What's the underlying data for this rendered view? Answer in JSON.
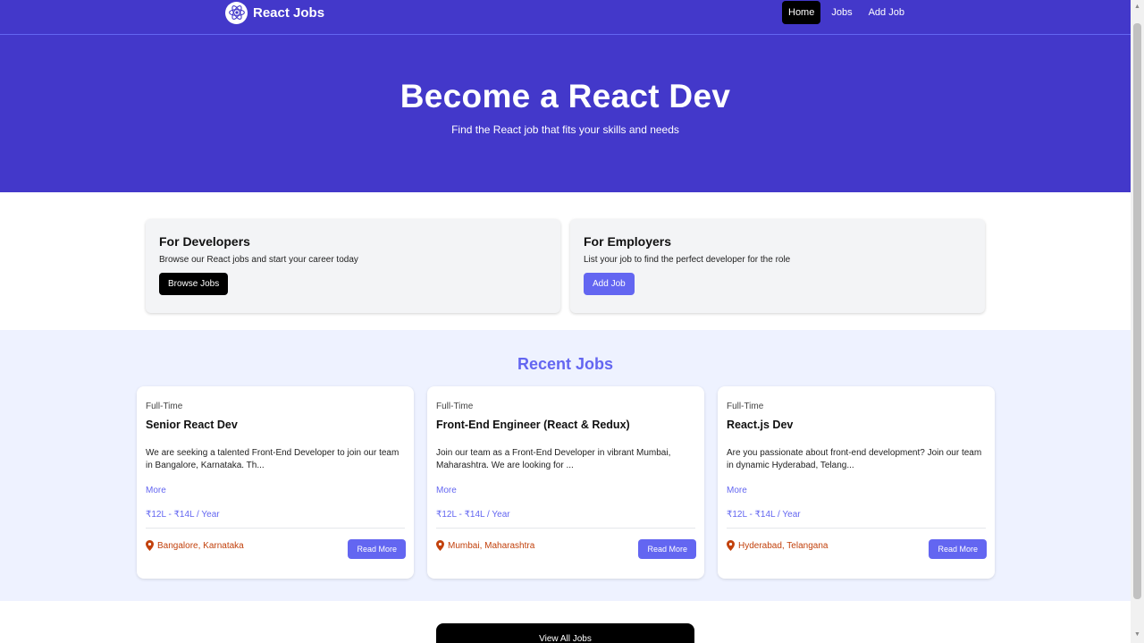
{
  "nav": {
    "brand": "React Jobs",
    "links": [
      "Home",
      "Jobs",
      "Add Job"
    ]
  },
  "hero": {
    "title": "Become a React Dev",
    "subtitle": "Find the React job that fits your skills and needs"
  },
  "info_cards": [
    {
      "title": "For Developers",
      "text": "Browse our React jobs and start your career today",
      "button": "Browse Jobs"
    },
    {
      "title": "For Employers",
      "text": "List your job to find the perfect developer for the role",
      "button": "Add Job"
    }
  ],
  "recent": {
    "title": "Recent Jobs",
    "jobs": [
      {
        "type": "Full-Time",
        "title": "Senior React Dev",
        "desc": "We are seeking a talented Front-End Developer to join our team in Bangalore, Karnataka. Th...",
        "more": "More",
        "salary": "₹12L - ₹14L / Year",
        "location": "Bangalore, Karnataka",
        "button": "Read More"
      },
      {
        "type": "Full-Time",
        "title": "Front-End Engineer (React & Redux)",
        "desc": "Join our team as a Front-End Developer in vibrant Mumbai, Maharashtra. We are looking for ...",
        "more": "More",
        "salary": "₹12L - ₹14L / Year",
        "location": "Mumbai, Maharashtra",
        "button": "Read More"
      },
      {
        "type": "Full-Time",
        "title": "React.js Dev",
        "desc": "Are you passionate about front-end development? Join our team in dynamic Hyderabad, Telang...",
        "more": "More",
        "salary": "₹12L - ₹14L / Year",
        "location": "Hyderabad, Telangana",
        "button": "Read More"
      }
    ]
  },
  "view_all": "View All Jobs",
  "colors": {
    "primary": "#4338ca",
    "accent": "#6366f1",
    "location": "#c2410c"
  }
}
